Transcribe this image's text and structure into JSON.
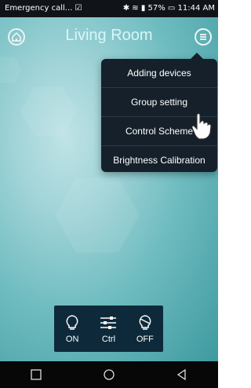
{
  "statusbar": {
    "left_text": "Emergency call... ☑",
    "right_text": "✱ ≋ ▮ 57% ▭ 11:44 AM"
  },
  "header": {
    "title": "Living Room",
    "home_icon": "home-icon",
    "menu_icon": "menu-icon"
  },
  "dropdown": {
    "items": [
      {
        "label": "Adding devices"
      },
      {
        "label": "Group setting"
      },
      {
        "label": "Control Scheme"
      },
      {
        "label": "Brightness Calibration"
      }
    ]
  },
  "controls": {
    "on_label": "ON",
    "ctrl_label": "Ctrl",
    "off_label": "OFF"
  },
  "navbar": {
    "recents_icon": "square-icon",
    "home_icon": "circle-icon",
    "back_icon": "triangle-back-icon"
  },
  "colors": {
    "background_top": "#bfe3e6",
    "background_bottom": "#3e9aa0",
    "menu_bg": "#15202b",
    "controlbar_bg": "#0e2a3a"
  }
}
